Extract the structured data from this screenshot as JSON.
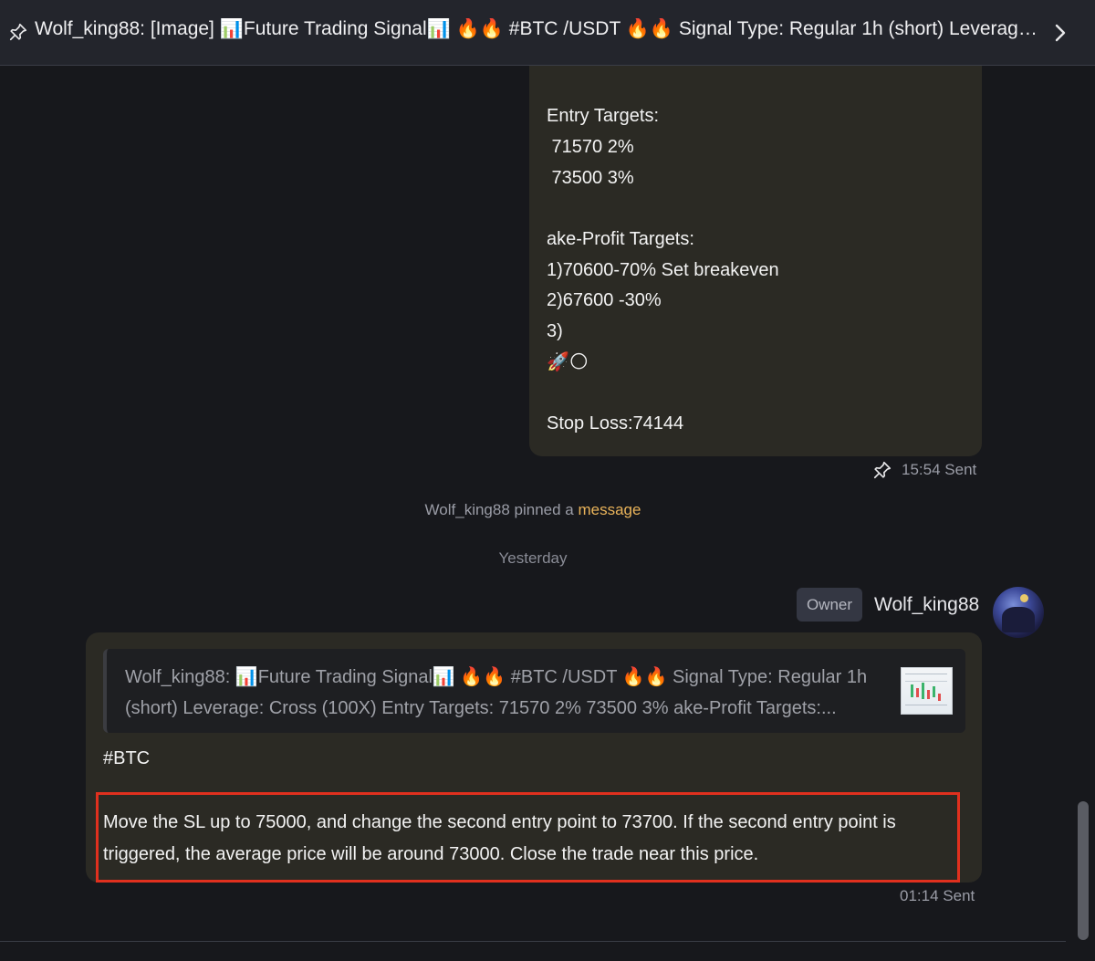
{
  "header": {
    "title": "Wolf_king88: [Image] 📊Future Trading Signal📊 🔥🔥 #BTC /USDT 🔥🔥 Signal Type: Regular 1h (short) Leverage: Cross (100X)…"
  },
  "pinned_message": {
    "lines": [
      "Entry Targets:",
      " 71570 2%",
      " 73500 3%",
      "ake-Profit Targets:",
      "1)70600-70% Set breakeven",
      "2)67600 -30%",
      "3)",
      "🚀🌕",
      "Stop Loss:74144"
    ],
    "time": "15:54",
    "status": "Sent"
  },
  "system": {
    "pinned_prefix": "Wolf_king88 pinned a ",
    "pinned_link": "message",
    "date_divider": "Yesterday"
  },
  "message": {
    "badge": "Owner",
    "sender": "Wolf_king88",
    "reply_preview": "Wolf_king88: 📊Future Trading Signal📊 🔥🔥 #BTC /USDT 🔥🔥 Signal Type: Regular 1h (short) Leverage: Cross (100X) Entry Targets: 71570 2% 73500 3% ake-Profit Targets:...",
    "hashtag": "#BTC",
    "body": "Move the SL up to 75000, and change the second entry point to 73700. If the second entry point is triggered, the average price will be around 73000. Close the trade near this price.",
    "time": "01:14",
    "status": "Sent"
  },
  "colors": {
    "background": "#17181c",
    "bubble": "#2b2a24",
    "link": "#e9b35a",
    "highlight_box": "#e0301e"
  },
  "icons": [
    "pin-icon",
    "chevron-right-icon",
    "avatar"
  ]
}
